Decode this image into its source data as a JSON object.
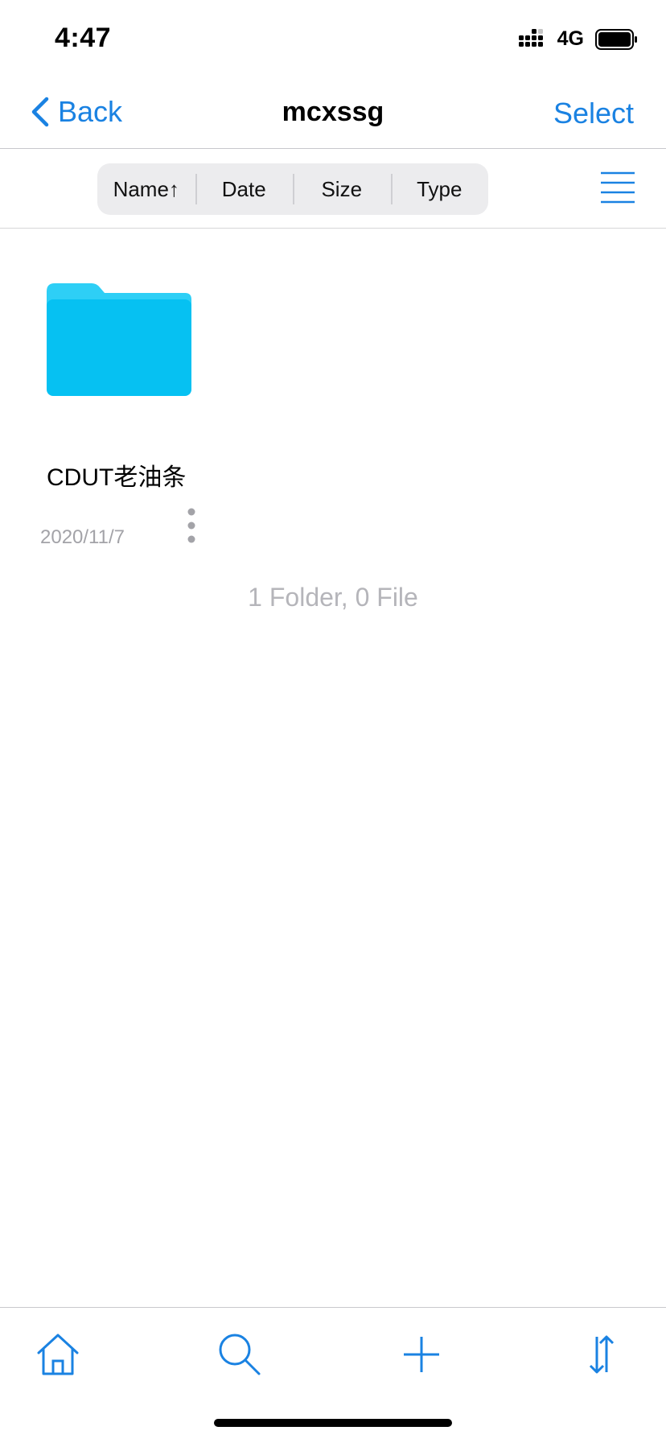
{
  "status_bar": {
    "time": "4:47",
    "network": "4G",
    "icons": [
      "signal-icon",
      "battery-icon"
    ]
  },
  "nav": {
    "back_label": "Back",
    "title": "mcxssg",
    "select_label": "Select",
    "accent_color": "#1a82e2"
  },
  "sort": {
    "options": [
      {
        "label": "Name↑"
      },
      {
        "label": "Date"
      },
      {
        "label": "Size"
      },
      {
        "label": "Type"
      }
    ]
  },
  "items": [
    {
      "type": "folder",
      "name": "CDUT老油条",
      "date": "2020/11/7",
      "icon": "folder-icon",
      "color": "#06c1f2"
    }
  ],
  "summary": "1 Folder, 0 File",
  "toolbar": {
    "icons": [
      "home-icon",
      "search-icon",
      "plus-icon",
      "sort-arrows-icon"
    ]
  }
}
